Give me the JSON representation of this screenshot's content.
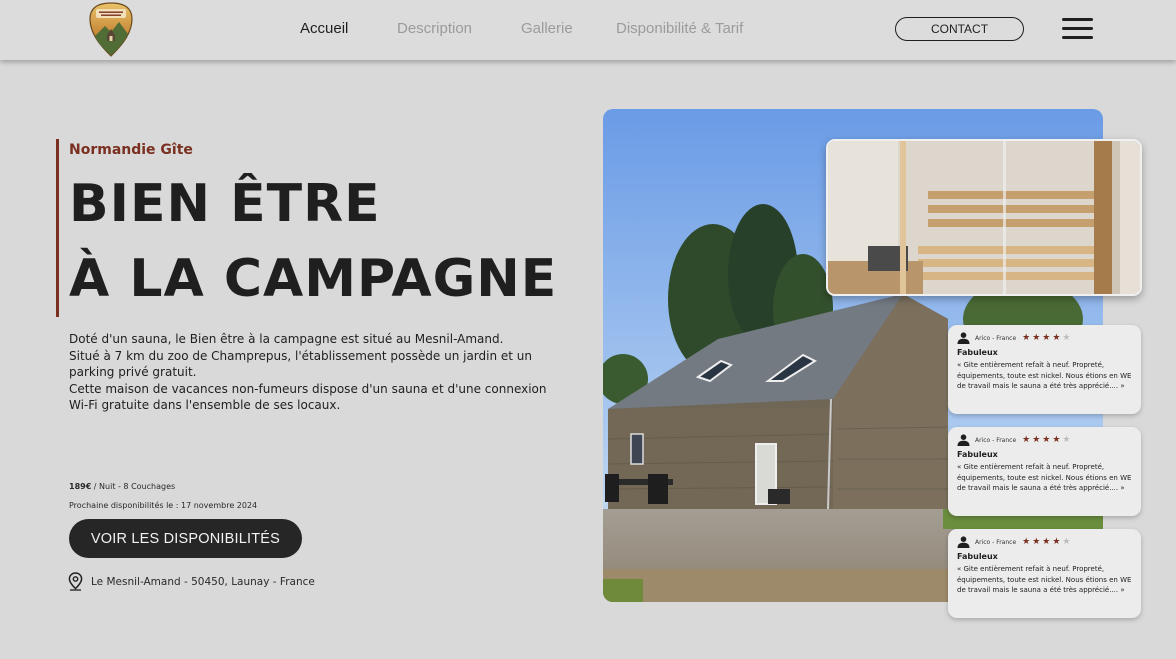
{
  "header": {
    "nav": [
      {
        "label": "Accueil",
        "active": true
      },
      {
        "label": "Description",
        "active": false
      },
      {
        "label": "Gallerie",
        "active": false
      },
      {
        "label": "Disponibilité & Tarif",
        "active": false
      }
    ],
    "contact_label": "CONTACT",
    "menu_icon": "hamburger-icon",
    "logo_icon": "gite-logo-icon"
  },
  "hero": {
    "subtitle": "Normandie Gîte",
    "title_line1": "BIEN ÊTRE",
    "title_line2": "À LA CAMPAGNE",
    "description": [
      "Doté d'un sauna, le Bien être à la campagne est situé au Mesnil-Amand.",
      "Situé à 7 km du zoo de Champrepus, l'établissement possède un jardin et un parking privé gratuit.",
      "Cette maison de vacances non-fumeurs dispose d'un sauna et d'une connexion Wi-Fi gratuite dans l'ensemble de ses locaux."
    ],
    "price": "189€",
    "price_detail": " / Nuit - 8 Couchages",
    "next_availability": "Prochaine disponibilités le : 17 novembre 2024",
    "cta_label": "VOIR LES DISPONIBILITÉS",
    "location": "Le Mesnil-Amand - 50450, Launay - France",
    "location_icon": "location-pin-icon"
  },
  "reviews": [
    {
      "author": "Arico - France",
      "stars": 4,
      "max_stars": 5,
      "title": "Fabuleux",
      "text": "« Gite entièrement refait à neuf. Propreté, équipements, toute est nickel. Nous étions en WE de travail mais le sauna a été très apprécié.... »"
    },
    {
      "author": "Arico - France",
      "stars": 4,
      "max_stars": 5,
      "title": "Fabuleux",
      "text": "« Gite entièrement refait à neuf. Propreté, équipements, toute est nickel. Nous étions en WE de travail mais le sauna a été très apprécié.... »"
    },
    {
      "author": "Arico - France",
      "stars": 4,
      "max_stars": 5,
      "title": "Fabuleux",
      "text": "« Gite entièrement refait à neuf. Propreté, équipements, toute est nickel. Nous étions en WE de travail mais le sauna a été très apprécié.... »"
    }
  ],
  "colors": {
    "background": "#d9d9d9",
    "accent": "#7a3020",
    "text": "#1f1f1f",
    "nav_inactive": "#9b9b9b",
    "button": "#262626"
  }
}
